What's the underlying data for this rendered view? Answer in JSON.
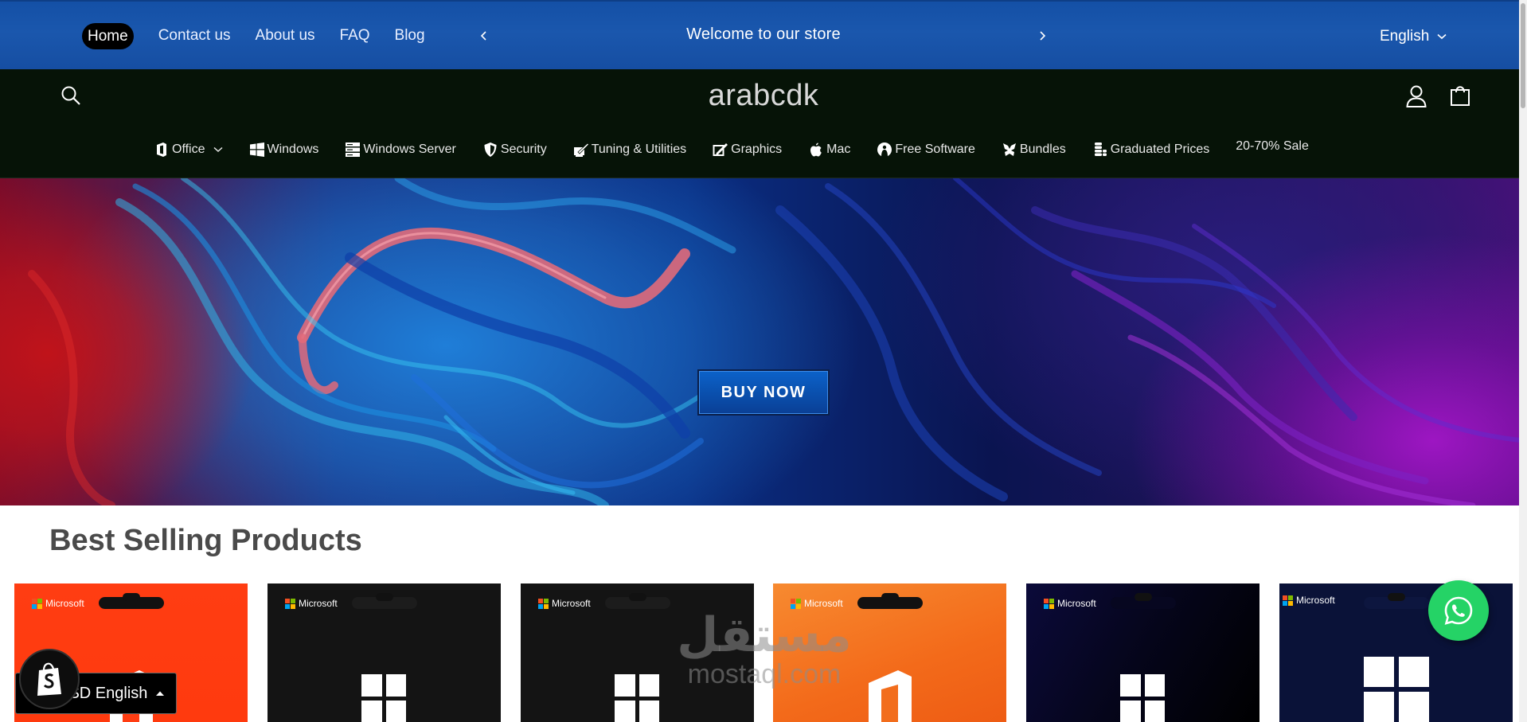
{
  "announcement": {
    "links": [
      {
        "label": "Home",
        "active": true
      },
      {
        "label": "Contact us"
      },
      {
        "label": "About us"
      },
      {
        "label": "FAQ"
      },
      {
        "label": "Blog"
      }
    ],
    "message": "Welcome to our store",
    "language": "English"
  },
  "header": {
    "logo": "arabcdk",
    "nav": [
      {
        "label": "Office",
        "icon": "office-icon",
        "dropdown": true
      },
      {
        "label": "Windows",
        "icon": "windows-icon"
      },
      {
        "label": "Windows Server",
        "icon": "server-icon"
      },
      {
        "label": "Security",
        "icon": "shield-icon"
      },
      {
        "label": "Tuning & Utilities",
        "icon": "tuning-icon"
      },
      {
        "label": "Graphics",
        "icon": "graphics-icon"
      },
      {
        "label": "Mac",
        "icon": "apple-icon"
      },
      {
        "label": "Free Software",
        "icon": "free-software-icon"
      },
      {
        "label": "Bundles",
        "icon": "bundles-icon"
      },
      {
        "label": "Graduated Prices",
        "icon": "coins-icon"
      }
    ],
    "sale_label": "20-70% Sale"
  },
  "hero": {
    "button_label": "BUY NOW"
  },
  "products": {
    "title": "Best Selling Products",
    "cards": [
      {
        "brand": "Microsoft",
        "style": "orange-red",
        "logo": "office-logo"
      },
      {
        "brand": "Microsoft",
        "style": "black",
        "logo": "windows-logo"
      },
      {
        "brand": "Microsoft",
        "style": "black",
        "logo": "windows-logo"
      },
      {
        "brand": "Microsoft",
        "style": "orange",
        "logo": "office-logo"
      },
      {
        "brand": "Microsoft",
        "style": "dark-blue",
        "logo": "windows-logo"
      },
      {
        "brand": "Microsoft",
        "style": "navy",
        "logo": "windows-logo"
      }
    ]
  },
  "currency_selector": {
    "label": "USD English"
  },
  "watermark": {
    "arabic": "مستقل",
    "domain": "mostaql.com"
  },
  "colors": {
    "announcement_bg": "#1a57ad",
    "header_bg": "#061307",
    "whatsapp": "#25d366",
    "buy_button": "#0b62c9"
  }
}
